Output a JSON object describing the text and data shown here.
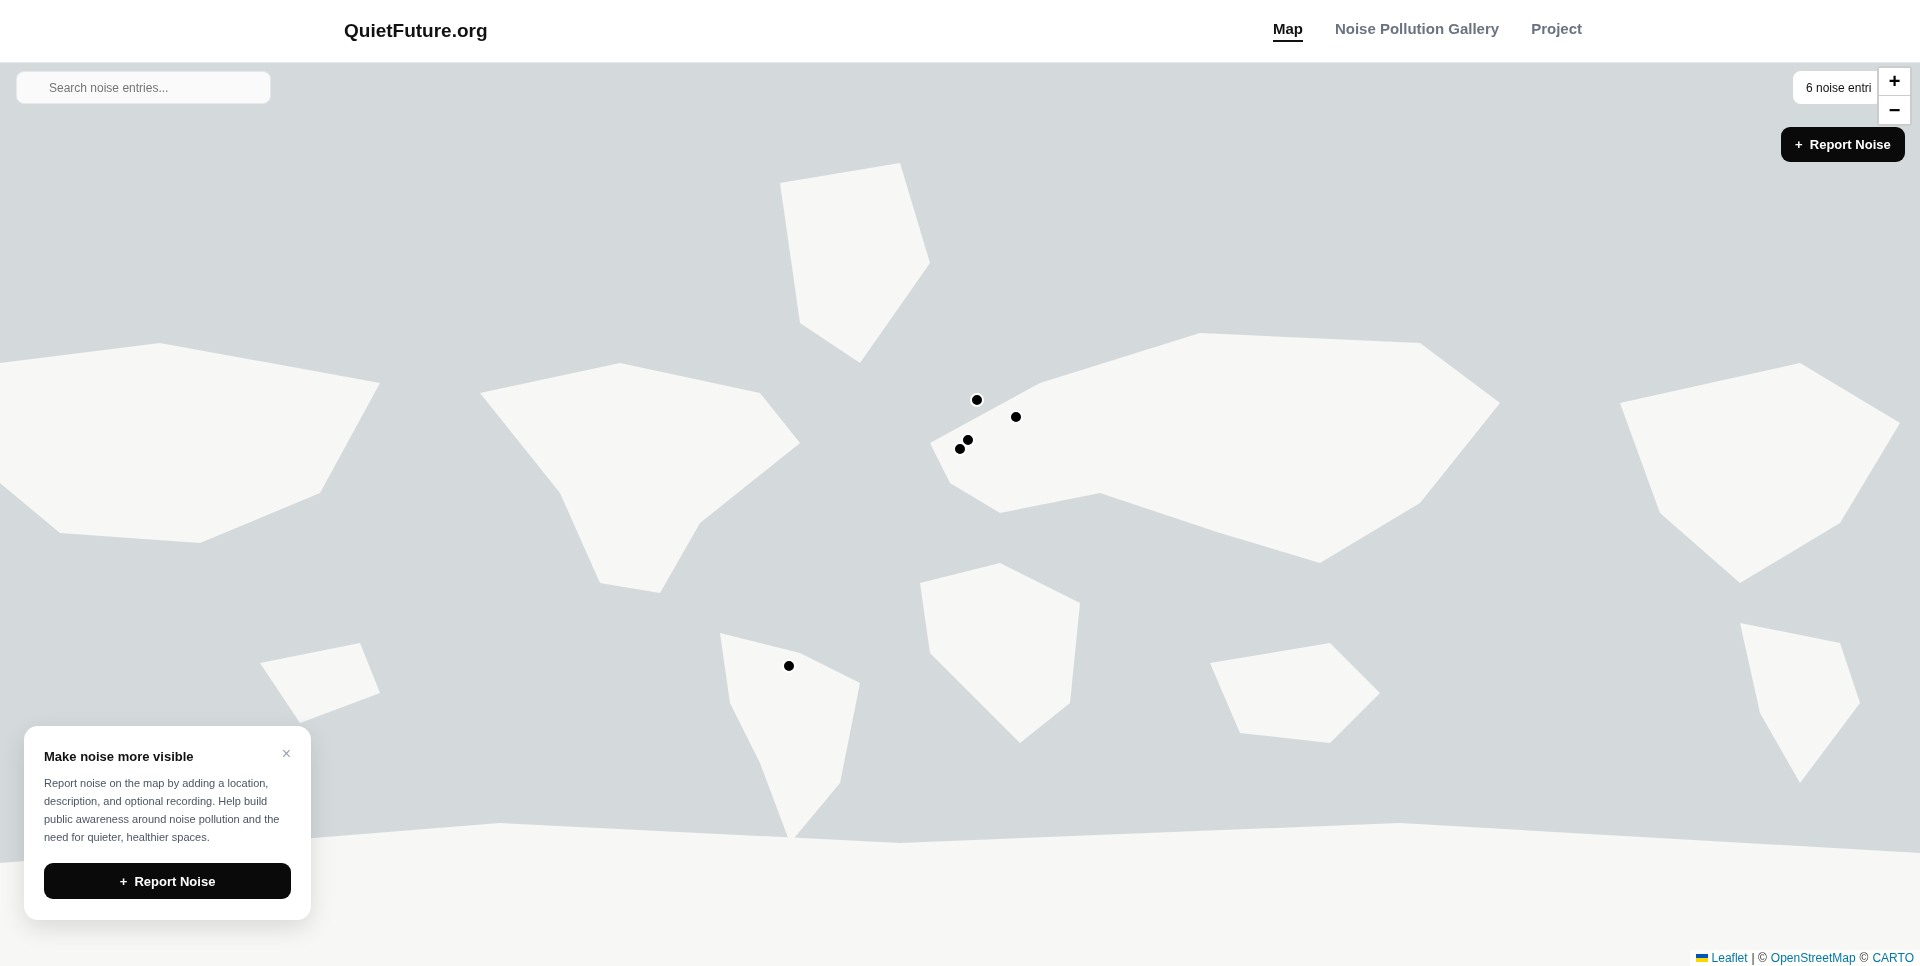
{
  "header": {
    "logo": "QuietFuture.org",
    "nav": [
      {
        "label": "Map",
        "selected": true
      },
      {
        "label": "Noise Pollution Gallery",
        "selected": false
      },
      {
        "label": "Project",
        "selected": false
      }
    ]
  },
  "search": {
    "placeholder": "Search noise entries..."
  },
  "entry_count": "6 noise entri",
  "zoom": {
    "in": "+",
    "out": "−"
  },
  "report_button": {
    "icon": "+",
    "label": "Report Noise"
  },
  "info_card": {
    "title": "Make noise more visible",
    "close": "×",
    "text": "Report noise on the map by adding a location, description, and optional recording. Help build public awareness around noise pollution and the need for quieter, healthier spaces.",
    "button": {
      "icon": "+",
      "label": "Report Noise"
    }
  },
  "attribution": {
    "links": [
      {
        "label": "Leaflet"
      },
      {
        "label": "OpenStreetMap"
      },
      {
        "label": "CARTO"
      }
    ],
    "separators": [
      "| ©",
      "©"
    ]
  }
}
